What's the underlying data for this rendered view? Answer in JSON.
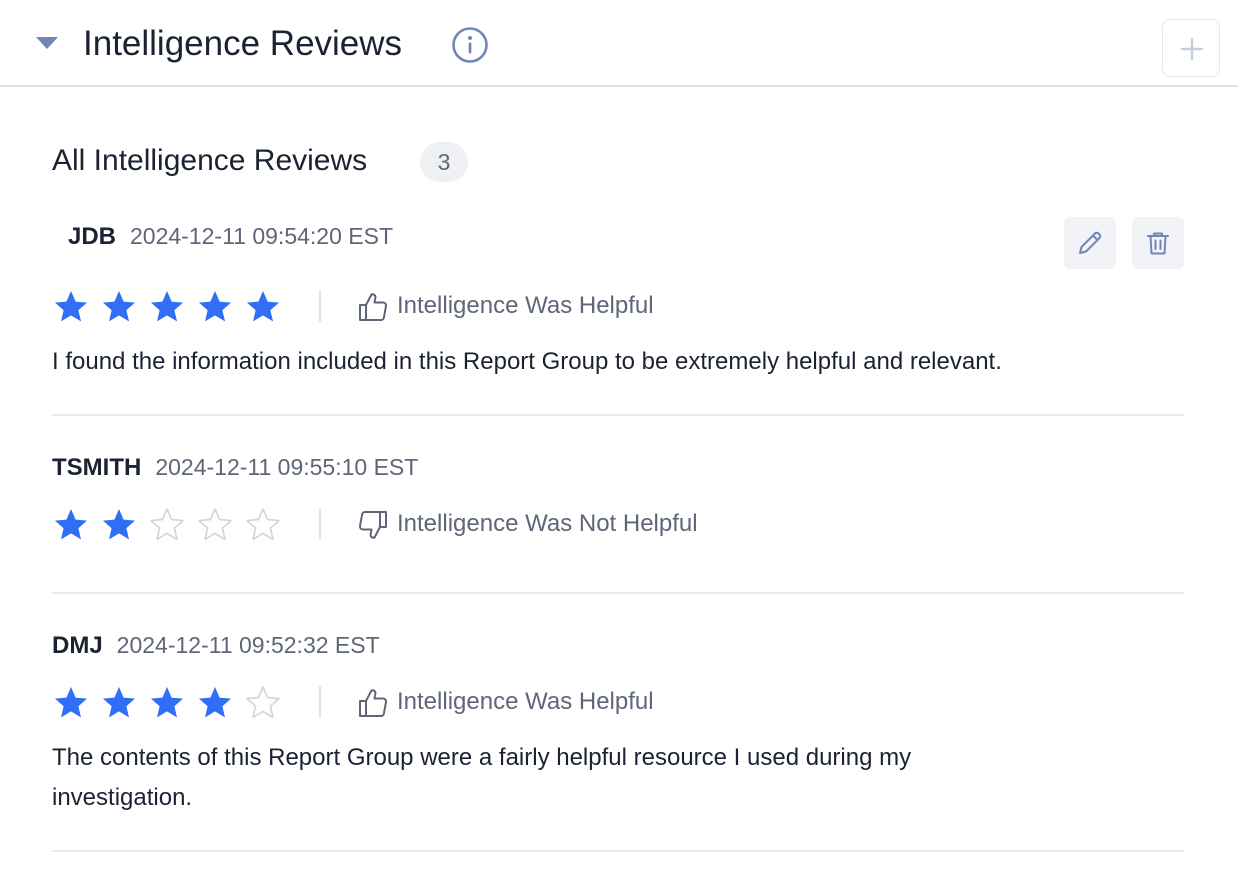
{
  "section": {
    "title": "Intelligence Reviews",
    "caret_icon": "caret-down-icon",
    "info_icon": "info-icon",
    "add_icon": "plus-icon"
  },
  "list": {
    "title": "All Intelligence Reviews",
    "count": "3"
  },
  "colors": {
    "star_filled": "#2f6ff5",
    "star_empty": "#d0d4dc",
    "muted_text": "#5e6678",
    "accent_icon": "#6f86b8"
  },
  "reviews": [
    {
      "author": "JDB",
      "timestamp": "2024-12-11 09:54:20 EST",
      "rating": 5,
      "max_rating": 5,
      "helpful": true,
      "helpful_label": "Intelligence Was Helpful",
      "comment_lines": [
        "I found the information included in this Report Group to be extremely helpful and relevant."
      ],
      "actions": {
        "edit_icon": "pencil-icon",
        "delete_icon": "trash-icon"
      }
    },
    {
      "author": "TSMITH",
      "timestamp": "2024-12-11 09:55:10 EST",
      "rating": 2,
      "max_rating": 5,
      "helpful": false,
      "helpful_label": "Intelligence Was Not Helpful",
      "comment_lines": []
    },
    {
      "author": "DMJ",
      "timestamp": "2024-12-11 09:52:32 EST",
      "rating": 4,
      "max_rating": 5,
      "helpful": true,
      "helpful_label": "Intelligence Was Helpful",
      "comment_lines": [
        "The contents of this Report Group were a fairly helpful resource I used during my",
        "investigation."
      ]
    }
  ]
}
